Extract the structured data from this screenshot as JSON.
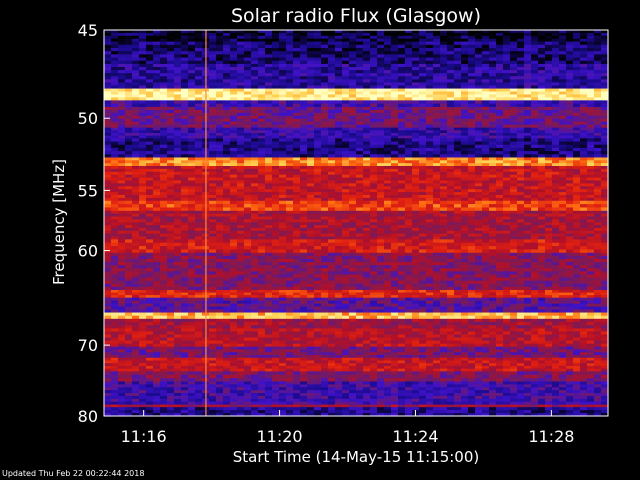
{
  "chart_data": {
    "type": "heatmap",
    "title": "Solar radio Flux (Glasgow)",
    "xlabel": "Start Time (14-May-15 11:15:00)",
    "ylabel": "Frequency [MHz]",
    "x_range_minutes": [
      "11:14:50",
      "11:29:40"
    ],
    "x_ticks": [
      "11:16",
      "11:20",
      "11:24",
      "11:28"
    ],
    "y_ticks": [
      45,
      50,
      55,
      60,
      70,
      80
    ],
    "ylim": [
      80,
      45
    ],
    "y_scale": "reciprocal",
    "colormap": [
      "#000000",
      "#1a0a8c",
      "#3f12c8",
      "#7a1a5a",
      "#b0102a",
      "#e02010",
      "#ff6a10",
      "#ffd050",
      "#ffffc0"
    ],
    "bands": [
      {
        "freq": [
          45.0,
          45.6
        ],
        "level": 0.05
      },
      {
        "freq": [
          45.6,
          46.8
        ],
        "level": 0.12
      },
      {
        "freq": [
          46.8,
          48.2
        ],
        "level": 0.18
      },
      {
        "freq": [
          48.2,
          48.9
        ],
        "level": 0.95
      },
      {
        "freq": [
          48.9,
          49.3
        ],
        "level": 0.25
      },
      {
        "freq": [
          49.3,
          50.6
        ],
        "level": 0.35
      },
      {
        "freq": [
          50.6,
          51.3
        ],
        "level": 0.22
      },
      {
        "freq": [
          51.3,
          52.6
        ],
        "level": 0.14
      },
      {
        "freq": [
          52.6,
          53.2
        ],
        "level": 0.78
      },
      {
        "freq": [
          53.2,
          55.8
        ],
        "level": 0.55
      },
      {
        "freq": [
          55.8,
          56.6
        ],
        "level": 0.68
      },
      {
        "freq": [
          56.6,
          59.0
        ],
        "level": 0.48
      },
      {
        "freq": [
          59.0,
          60.2
        ],
        "level": 0.58
      },
      {
        "freq": [
          60.2,
          63.8
        ],
        "level": 0.4
      },
      {
        "freq": [
          63.8,
          64.6
        ],
        "level": 0.62
      },
      {
        "freq": [
          64.6,
          66.2
        ],
        "level": 0.3
      },
      {
        "freq": [
          66.2,
          66.9
        ],
        "level": 0.85
      },
      {
        "freq": [
          66.9,
          68.0
        ],
        "level": 0.46
      },
      {
        "freq": [
          68.0,
          70.2
        ],
        "level": 0.52
      },
      {
        "freq": [
          70.2,
          71.6
        ],
        "level": 0.36
      },
      {
        "freq": [
          71.6,
          73.4
        ],
        "level": 0.55
      },
      {
        "freq": [
          73.4,
          74.8
        ],
        "level": 0.38
      },
      {
        "freq": [
          74.8,
          78.2
        ],
        "level": 0.24
      },
      {
        "freq": [
          78.2,
          78.6
        ],
        "level": 0.45
      },
      {
        "freq": [
          78.6,
          80.0
        ],
        "level": 0.15
      }
    ],
    "vertical_line_time": "11:17:50"
  },
  "footer": {
    "updated": "Updated Thu Feb 22 00:22:44 2018"
  }
}
